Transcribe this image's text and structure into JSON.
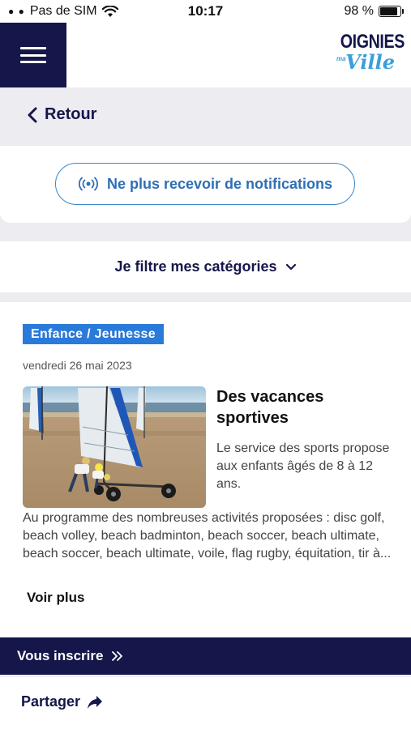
{
  "status_bar": {
    "carrier": "Pas de SIM",
    "time": "10:17",
    "battery": "98 %"
  },
  "header": {
    "logo_main": "OIGNIES",
    "logo_mini": "ma",
    "logo_script": "Ville"
  },
  "nav": {
    "back_label": "Retour"
  },
  "notifications": {
    "button_label": "Ne plus recevoir de notifications"
  },
  "filter": {
    "label": "Je filtre mes catégories"
  },
  "article": {
    "category": "Enfance / Jeunesse",
    "date": "vendredi 26 mai 2023",
    "title": "Des vacances sportives",
    "lead": "Le service des sports propose aux enfants âgés de 8 à 12 ans.",
    "body": "Au programme des nombreuses activités proposées : disc golf, beach volley, beach badminton, beach soccer, beach ultimate, beach soccer, beach ultimate, voile, flag rugby, équitation, tir à...",
    "more_label": "Voir plus"
  },
  "actions": {
    "register_label": "Vous inscrire",
    "share_label": "Partager"
  },
  "colors": {
    "navy": "#15164a",
    "accent_blue": "#2a7ad9",
    "outline_blue": "#3a86c8",
    "background": "#ececf1"
  }
}
